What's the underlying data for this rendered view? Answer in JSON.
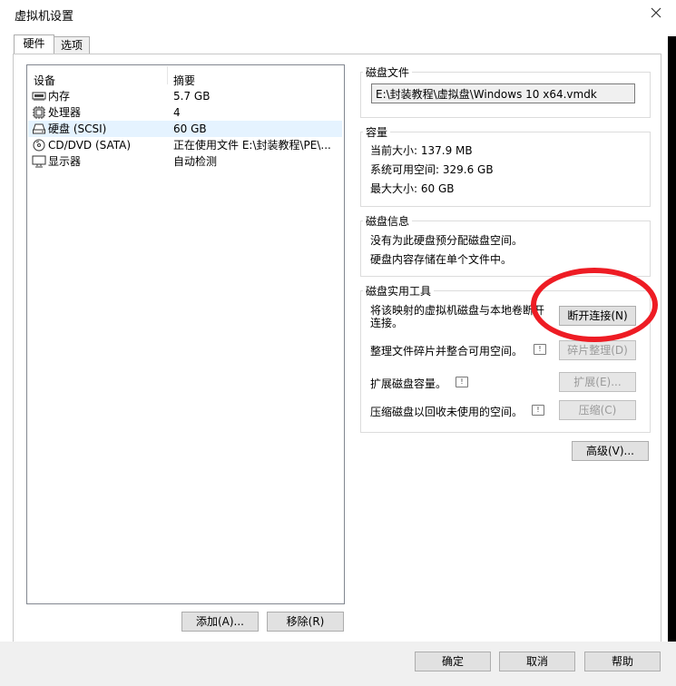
{
  "window": {
    "title": "虚拟机设置"
  },
  "tabs": [
    {
      "label": "硬件"
    },
    {
      "label": "选项"
    }
  ],
  "device_list": {
    "headers": {
      "device": "设备",
      "summary": "摘要"
    },
    "items": [
      {
        "icon": "memory-icon",
        "name": "内存",
        "summary": "5.7 GB"
      },
      {
        "icon": "processor-icon",
        "name": "处理器",
        "summary": "4"
      },
      {
        "icon": "harddisk-icon",
        "name": "硬盘 (SCSI)",
        "summary": "60 GB"
      },
      {
        "icon": "cdrom-icon",
        "name": "CD/DVD (SATA)",
        "summary": "正在使用文件 E:\\封装教程\\PE\\..."
      },
      {
        "icon": "display-icon",
        "name": "显示器",
        "summary": "自动检测"
      }
    ],
    "add_button": "添加(A)...",
    "remove_button": "移除(R)"
  },
  "disk_file": {
    "label": "磁盘文件",
    "value": "E:\\封装教程\\虚拟盘\\Windows 10 x64.vmdk"
  },
  "capacity": {
    "label": "容量",
    "current": "当前大小: 137.9 MB",
    "available": "系统可用空间: 329.6 GB",
    "max": "最大大小: 60 GB"
  },
  "disk_info": {
    "label": "磁盘信息",
    "line1": "没有为此硬盘预分配磁盘空间。",
    "line2": "硬盘内容存储在单个文件中。"
  },
  "utilities": {
    "label": "磁盘实用工具",
    "map_text_1": "将该映射的虚拟机磁盘与本地卷断开",
    "map_text_2": "连接。",
    "disconnect_button": "断开连接(N)",
    "defrag_text": "整理文件碎片并整合可用空间。",
    "defrag_button": "碎片整理(D)",
    "expand_text": "扩展磁盘容量。",
    "expand_button": "扩展(E)...",
    "compact_text": "压缩磁盘以回收未使用的空间。",
    "compact_button": "压缩(C)"
  },
  "advanced_button": "高级(V)...",
  "footer": {
    "ok": "确定",
    "cancel": "取消",
    "help": "帮助"
  },
  "colors": {
    "selection": "#e5f3ff",
    "annotation": "#ee1c24"
  }
}
